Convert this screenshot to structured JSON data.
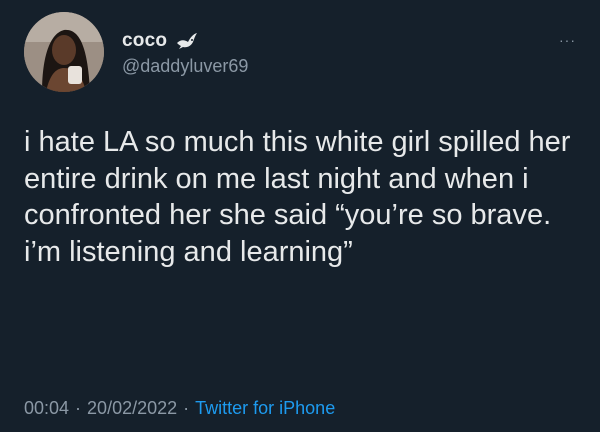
{
  "user": {
    "display_name": "coco",
    "handle": "@daddyluver69",
    "badge_icon": "dove-icon"
  },
  "menu": {
    "more_label": "···"
  },
  "tweet": {
    "text": "i hate LA so much this white girl spilled her entire drink on me last night and when i confronted her she said “you’re so brave. i’m listening and learning”"
  },
  "meta": {
    "time": "00:04",
    "separator": "·",
    "date": "20/02/2022",
    "source": "Twitter for iPhone"
  },
  "colors": {
    "background": "#15202b",
    "text": "#e7e9ea",
    "secondary": "#8b98a5",
    "link": "#1d9bf0"
  }
}
